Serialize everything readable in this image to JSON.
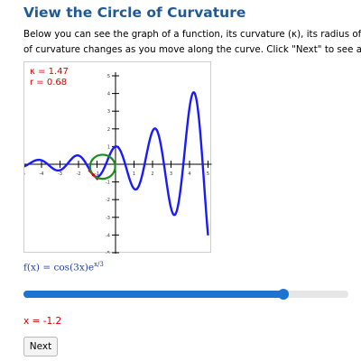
{
  "header": {
    "title": "View the Circle of Curvature",
    "description_line1": "Below you can see the graph of a function, its curvature (κ), its radius of curvature",
    "description_line2": "of curvature changes as you move along the curve. Click \"Next\" to see a new"
  },
  "readout": {
    "kappa": "κ = 1.47",
    "radius": "r = 0.68"
  },
  "function_label": {
    "lhs": "f(x) = cos(3x)e",
    "exponent": "x/3"
  },
  "controls": {
    "slider_value": 0.8,
    "x_label": "x = -1.2",
    "next_label": "Next"
  },
  "colors": {
    "curve": "#1a1aff",
    "circle": "#1a8c1a",
    "tangent": "#d60000",
    "accent": "#1e73d1",
    "title": "#1f5a96"
  },
  "chart_data": {
    "type": "line",
    "function": "cos(3x)e^(x/3)",
    "xlim": [
      -5,
      5
    ],
    "ylim": [
      -5,
      5
    ],
    "x_ticks": [
      "-5",
      "-4",
      "-3",
      "-2",
      "-1",
      "1",
      "2",
      "3",
      "4",
      "5"
    ],
    "y_ticks": [
      "5",
      "4",
      "3",
      "2",
      "1",
      "-1",
      "-2",
      "-3",
      "-4",
      "-5"
    ],
    "point_x": -1.2,
    "curvature": 1.47,
    "radius": 0.68
  }
}
